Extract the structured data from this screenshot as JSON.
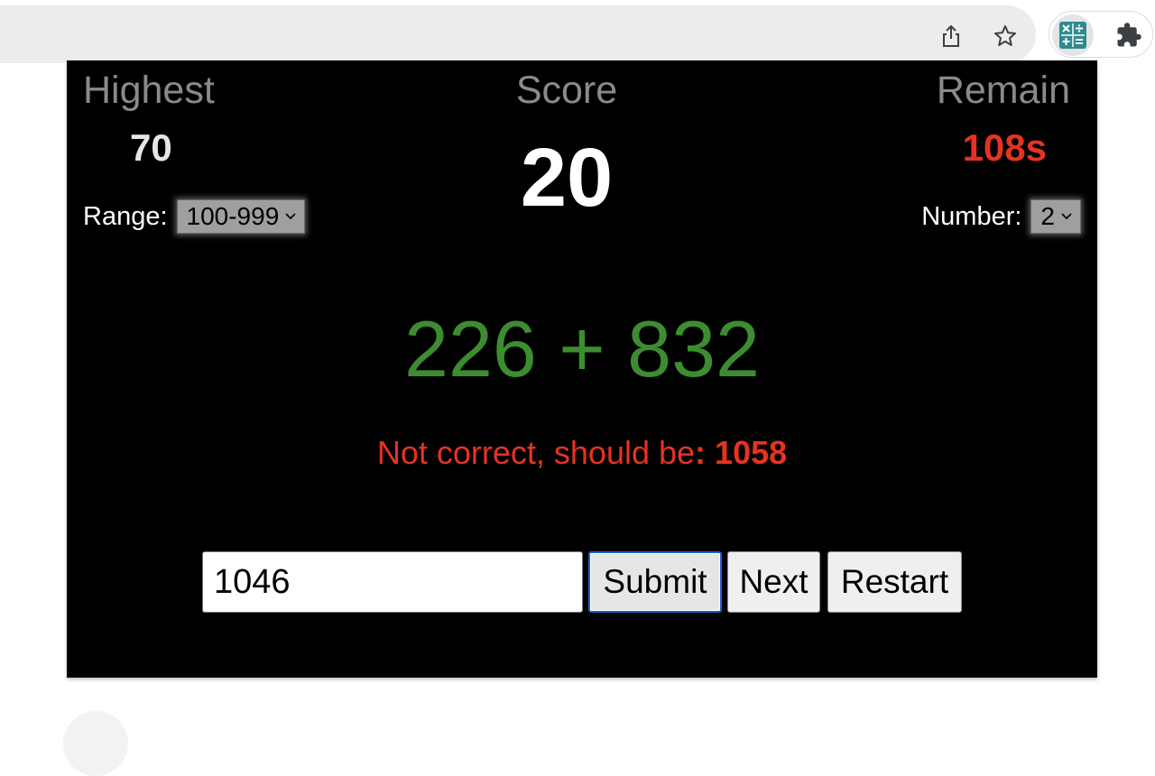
{
  "browser": {
    "toolbar_icons": [
      "share-icon",
      "star-icon",
      "calculator-extension-icon",
      "puzzle-icon"
    ]
  },
  "game": {
    "highest_label": "Highest",
    "highest_value": "70",
    "score_label": "Score",
    "score_value": "20",
    "remain_label": "Remain",
    "remain_value": "108s",
    "range_label": "Range:",
    "range_value": "100-999",
    "number_label": "Number:",
    "number_value": "2",
    "question": "226 + 832",
    "feedback_text": "Not correct, should be",
    "feedback_colon": ": ",
    "feedback_answer": "1058",
    "answer_input_value": "1046",
    "submit_label": "Submit",
    "next_label": "Next",
    "restart_label": "Restart"
  },
  "colors": {
    "background": "#000000",
    "label_gray": "#8a8a8a",
    "remain_red": "#e53322",
    "question_green": "#3c8d2f",
    "feedback_red": "#e53322",
    "submit_focus_blue": "#1a5fd0"
  }
}
